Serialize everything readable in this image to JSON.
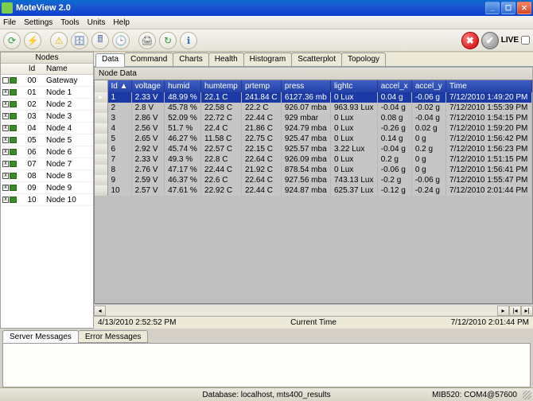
{
  "title": "MoteView 2.0",
  "menu": [
    "File",
    "Settings",
    "Tools",
    "Units",
    "Help"
  ],
  "toolbar_icons": [
    {
      "name": "refresh-icon",
      "glyph": "⟳",
      "color": "#2a9d3a"
    },
    {
      "name": "lightning-icon",
      "glyph": "⚡",
      "color": "#e08a1e"
    },
    {
      "name": "warning-icon",
      "glyph": "⚠",
      "color": "#e8b500"
    },
    {
      "name": "database-icon",
      "glyph": "🗄",
      "color": "#4a6fb5"
    },
    {
      "name": "calculator-icon",
      "glyph": "🖩",
      "color": "#5a7aa5"
    },
    {
      "name": "clock-icon",
      "glyph": "🕒",
      "color": "#5a7aa5"
    },
    {
      "name": "print-icon",
      "glyph": "🖨",
      "color": "#666"
    },
    {
      "name": "sync-icon",
      "glyph": "↻",
      "color": "#2a9d3a"
    },
    {
      "name": "info-icon",
      "glyph": "ℹ",
      "color": "#2a78c0"
    }
  ],
  "live_controls": {
    "stop_label": "✖",
    "check_label": "✔",
    "live_label": "LIVE"
  },
  "sidebar": {
    "header": "Nodes",
    "columns": [
      "Id",
      "Name"
    ],
    "rows": [
      {
        "id": "00",
        "name": "Gateway",
        "checked": false
      },
      {
        "id": "01",
        "name": "Node 1",
        "checked": true
      },
      {
        "id": "02",
        "name": "Node 2",
        "checked": true
      },
      {
        "id": "03",
        "name": "Node 3",
        "checked": true
      },
      {
        "id": "04",
        "name": "Node 4",
        "checked": true
      },
      {
        "id": "05",
        "name": "Node 5",
        "checked": true
      },
      {
        "id": "06",
        "name": "Node 6",
        "checked": true
      },
      {
        "id": "07",
        "name": "Node 7",
        "checked": true
      },
      {
        "id": "08",
        "name": "Node 8",
        "checked": true
      },
      {
        "id": "09",
        "name": "Node 9",
        "checked": true
      },
      {
        "id": "10",
        "name": "Node 10",
        "checked": true
      }
    ]
  },
  "tabs": [
    "Data",
    "Command",
    "Charts",
    "Health",
    "Histogram",
    "Scatterplot",
    "Topology"
  ],
  "active_tab": 0,
  "node_data_label": "Node Data",
  "grid": {
    "columns": [
      "Id ▲",
      "voltage",
      "humid",
      "humtemp",
      "prtemp",
      "press",
      "lightc",
      "accel_x",
      "accel_y",
      "Time"
    ],
    "rows": [
      {
        "id": "1",
        "voltage": "2.33 V",
        "humid": "48.99 %",
        "humtemp": "22.1 C",
        "prtemp": "241.84 C",
        "press": "6127.36 mb",
        "lightc": "0 Lux",
        "accel_x": "0.04 g",
        "accel_y": "-0.06 g",
        "time": "7/12/2010 1:49:20 PM"
      },
      {
        "id": "2",
        "voltage": "2.8 V",
        "humid": "45.78 %",
        "humtemp": "22.58 C",
        "prtemp": "22.2 C",
        "press": "926.07 mba",
        "lightc": "963.93 Lux",
        "accel_x": "-0.04 g",
        "accel_y": "-0.02 g",
        "time": "7/12/2010 1:55:39 PM"
      },
      {
        "id": "3",
        "voltage": "2.86 V",
        "humid": "52.09 %",
        "humtemp": "22.72 C",
        "prtemp": "22.44 C",
        "press": "929 mbar",
        "lightc": "0 Lux",
        "accel_x": "0.08 g",
        "accel_y": "-0.04 g",
        "time": "7/12/2010 1:54:15 PM"
      },
      {
        "id": "4",
        "voltage": "2.56 V",
        "humid": "51.7 %",
        "humtemp": "22.4 C",
        "prtemp": "21.86 C",
        "press": "924.79 mba",
        "lightc": "0 Lux",
        "accel_x": "-0.26 g",
        "accel_y": "0.02 g",
        "time": "7/12/2010 1:59:20 PM"
      },
      {
        "id": "5",
        "voltage": "2.65 V",
        "humid": "46.27 %",
        "humtemp": "11.58 C",
        "prtemp": "22.75 C",
        "press": "925.47 mba",
        "lightc": "0 Lux",
        "accel_x": "0.14 g",
        "accel_y": "0 g",
        "time": "7/12/2010 1:56:42 PM"
      },
      {
        "id": "6",
        "voltage": "2.92 V",
        "humid": "45.74 %",
        "humtemp": "22.57 C",
        "prtemp": "22.15 C",
        "press": "925.57 mba",
        "lightc": "3.22 Lux",
        "accel_x": "-0.04 g",
        "accel_y": "0.2 g",
        "time": "7/12/2010 1:56:23 PM"
      },
      {
        "id": "7",
        "voltage": "2.33 V",
        "humid": "49.3 %",
        "humtemp": "22.8 C",
        "prtemp": "22.64 C",
        "press": "926.09 mba",
        "lightc": "0 Lux",
        "accel_x": "0.2 g",
        "accel_y": "0 g",
        "time": "7/12/2010 1:51:15 PM"
      },
      {
        "id": "8",
        "voltage": "2.76 V",
        "humid": "47.17 %",
        "humtemp": "22.44 C",
        "prtemp": "21.92 C",
        "press": "878.54 mba",
        "lightc": "0 Lux",
        "accel_x": "-0.06 g",
        "accel_y": "0 g",
        "time": "7/12/2010 1:56:41 PM"
      },
      {
        "id": "9",
        "voltage": "2.59 V",
        "humid": "46.37 %",
        "humtemp": "22.6 C",
        "prtemp": "22.64 C",
        "press": "927.56 mba",
        "lightc": "743.13 Lux",
        "accel_x": "-0.2 g",
        "accel_y": "-0.06 g",
        "time": "7/12/2010 1:55:47 PM"
      },
      {
        "id": "10",
        "voltage": "2.57 V",
        "humid": "47.61 %",
        "humtemp": "22.92 C",
        "prtemp": "22.44 C",
        "press": "924.87 mba",
        "lightc": "625.37 Lux",
        "accel_x": "-0.12 g",
        "accel_y": "-0.24 g",
        "time": "7/12/2010 2:01:44 PM"
      }
    ]
  },
  "timebar": {
    "left": "4/13/2010 2:52:52 PM",
    "center": "Current Time",
    "right": "7/12/2010 2:01:44 PM"
  },
  "msg_tabs": [
    "Server Messages",
    "Error Messages"
  ],
  "status": {
    "db": "Database: localhost, mts400_results",
    "conn": "MIB520: COM4@57600"
  }
}
